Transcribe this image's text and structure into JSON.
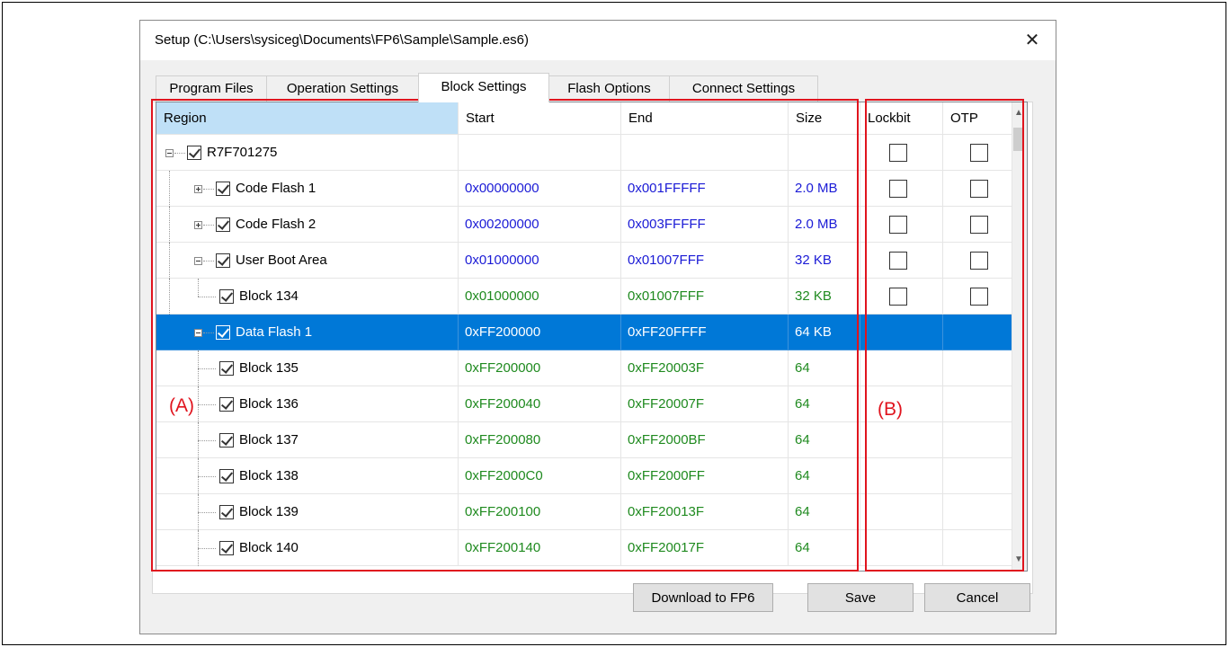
{
  "dialog": {
    "title": "Setup (C:\\Users\\sysiceg\\Documents\\FP6\\Sample\\Sample.es6)",
    "close_glyph": "✕"
  },
  "tabs": [
    {
      "label": "Program Files"
    },
    {
      "label": "Operation Settings"
    },
    {
      "label": "Block Settings",
      "active": true
    },
    {
      "label": "Flash Options"
    },
    {
      "label": "Connect Settings"
    }
  ],
  "grid": {
    "headers": {
      "region": "Region",
      "start": "Start",
      "end": "End",
      "size": "Size",
      "lockbit": "Lockbit",
      "otp": "OTP"
    },
    "rows": [
      {
        "name": "R7F701275",
        "start": "",
        "end": "",
        "size": "",
        "color": "",
        "level": 0,
        "expander": "minus",
        "lock_cb": true,
        "otp_cb": true
      },
      {
        "name": "Code Flash 1",
        "start": "0x00000000",
        "end": "0x001FFFFF",
        "size": "2.0 MB",
        "color": "blue",
        "level": 1,
        "expander": "plus",
        "lock_cb": true,
        "otp_cb": true
      },
      {
        "name": "Code Flash 2",
        "start": "0x00200000",
        "end": "0x003FFFFF",
        "size": "2.0 MB",
        "color": "blue",
        "level": 1,
        "expander": "plus",
        "lock_cb": true,
        "otp_cb": true
      },
      {
        "name": "User Boot Area",
        "start": "0x01000000",
        "end": "0x01007FFF",
        "size": "32 KB",
        "color": "blue",
        "level": 1,
        "expander": "minus",
        "lock_cb": true,
        "otp_cb": true
      },
      {
        "name": "Block 134",
        "start": "0x01000000",
        "end": "0x01007FFF",
        "size": "32 KB",
        "color": "green",
        "level": 2,
        "expander": "",
        "lock_cb": true,
        "otp_cb": true
      },
      {
        "name": "Data Flash 1",
        "start": "0xFF200000",
        "end": "0xFF20FFFF",
        "size": "64 KB",
        "color": "blue",
        "level": 1,
        "expander": "minus",
        "selected": true,
        "lock_cb": false,
        "otp_cb": false
      },
      {
        "name": "Block 135",
        "start": "0xFF200000",
        "end": "0xFF20003F",
        "size": "64",
        "color": "green",
        "level": 2,
        "expander": "",
        "lock_cb": false,
        "otp_cb": false
      },
      {
        "name": "Block 136",
        "start": "0xFF200040",
        "end": "0xFF20007F",
        "size": "64",
        "color": "green",
        "level": 2,
        "expander": "",
        "lock_cb": false,
        "otp_cb": false
      },
      {
        "name": "Block 137",
        "start": "0xFF200080",
        "end": "0xFF2000BF",
        "size": "64",
        "color": "green",
        "level": 2,
        "expander": "",
        "lock_cb": false,
        "otp_cb": false
      },
      {
        "name": "Block 138",
        "start": "0xFF2000C0",
        "end": "0xFF2000FF",
        "size": "64",
        "color": "green",
        "level": 2,
        "expander": "",
        "lock_cb": false,
        "otp_cb": false
      },
      {
        "name": "Block 139",
        "start": "0xFF200100",
        "end": "0xFF20013F",
        "size": "64",
        "color": "green",
        "level": 2,
        "expander": "",
        "lock_cb": false,
        "otp_cb": false
      },
      {
        "name": "Block 140",
        "start": "0xFF200140",
        "end": "0xFF20017F",
        "size": "64",
        "color": "green",
        "level": 2,
        "expander": "",
        "lock_cb": false,
        "otp_cb": false
      }
    ]
  },
  "buttons": {
    "download": "Download to FP6",
    "save": "Save",
    "cancel": "Cancel"
  },
  "annotations": {
    "a": "(A)",
    "b": "(B)"
  },
  "colors": {
    "selection": "#0078d7",
    "blue_text": "#1b1bd6",
    "green_text": "#1f8a1f",
    "annotation_red": "#e0141e",
    "header_selected": "#bfe0f7"
  }
}
